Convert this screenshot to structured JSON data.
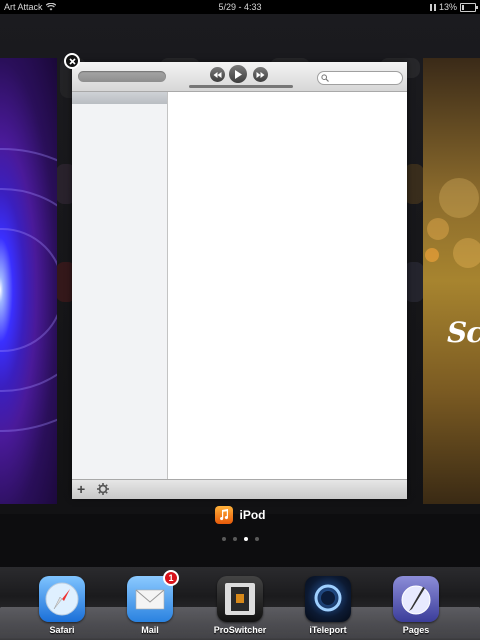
{
  "status_bar": {
    "carrier": "Art Attack",
    "time": "5/29 - 4:33",
    "battery_percent": "13%",
    "battery_level": 0.13
  },
  "switcher": {
    "current_app": {
      "name": "iPod",
      "icon": "ipod-icon"
    },
    "page_dots": {
      "count": 4,
      "active_index": 2
    },
    "window": {
      "search_placeholder": "",
      "toolbar_icons": [
        "previous-track-icon",
        "play-icon",
        "next-track-icon",
        "search-icon"
      ],
      "bottom_icons": [
        "add-icon",
        "gear-icon"
      ]
    }
  },
  "dock": {
    "apps": [
      {
        "label": "Safari",
        "icon": "safari-icon"
      },
      {
        "label": "Mail",
        "icon": "mail-icon",
        "badge": "1"
      },
      {
        "label": "ProSwitcher",
        "icon": "proswitcher-icon"
      },
      {
        "label": "iTeleport",
        "icon": "iteleport-icon"
      },
      {
        "label": "Pages",
        "icon": "pages-icon"
      }
    ]
  },
  "colors": {
    "badge_red": "#d8121a",
    "ipod_orange": "#f28a1e",
    "background": "#0d0d0f"
  }
}
